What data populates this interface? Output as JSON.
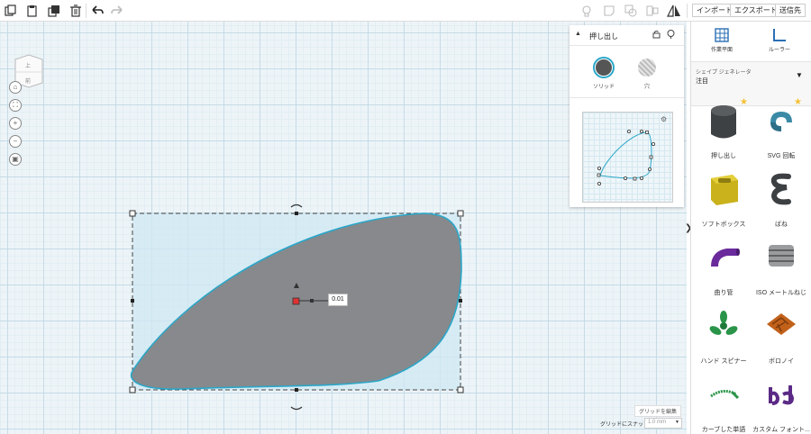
{
  "toolbar": {
    "import_label": "インポート",
    "export_label": "エクスポート",
    "send_label": "送信先"
  },
  "viewcube": {
    "top_label": "上",
    "front_label": "前"
  },
  "inspector": {
    "title": "押し出し",
    "solid_label": "ソリッド",
    "hole_label": "穴"
  },
  "canvas": {
    "dimension_value": "0.01",
    "edit_grid_label": "グリッドを編集",
    "snap_label": "グリッドにスナップ",
    "snap_value": "1.0 mm"
  },
  "sidebar": {
    "workplane_label": "作業平面",
    "ruler_label": "ルーラー",
    "dropdown_label": "シェイプ ジェネレータ",
    "dropdown_value": "注目",
    "shapes": [
      {
        "label": "押し出し"
      },
      {
        "label": "SVG 回転"
      },
      {
        "label": "ソフトボックス"
      },
      {
        "label": "ばね"
      },
      {
        "label": "曲り管"
      },
      {
        "label": "ISO メートルねじ"
      },
      {
        "label": "ハンド スピナー"
      },
      {
        "label": "ボロノイ"
      },
      {
        "label": "カーブした単語"
      },
      {
        "label": "カスタム フォント..."
      }
    ]
  },
  "colors": {
    "accent": "#2aa7c9",
    "shape_fill": "#888a8c",
    "selection_fill": "#cfe8f3",
    "handle_red": "#d33"
  }
}
